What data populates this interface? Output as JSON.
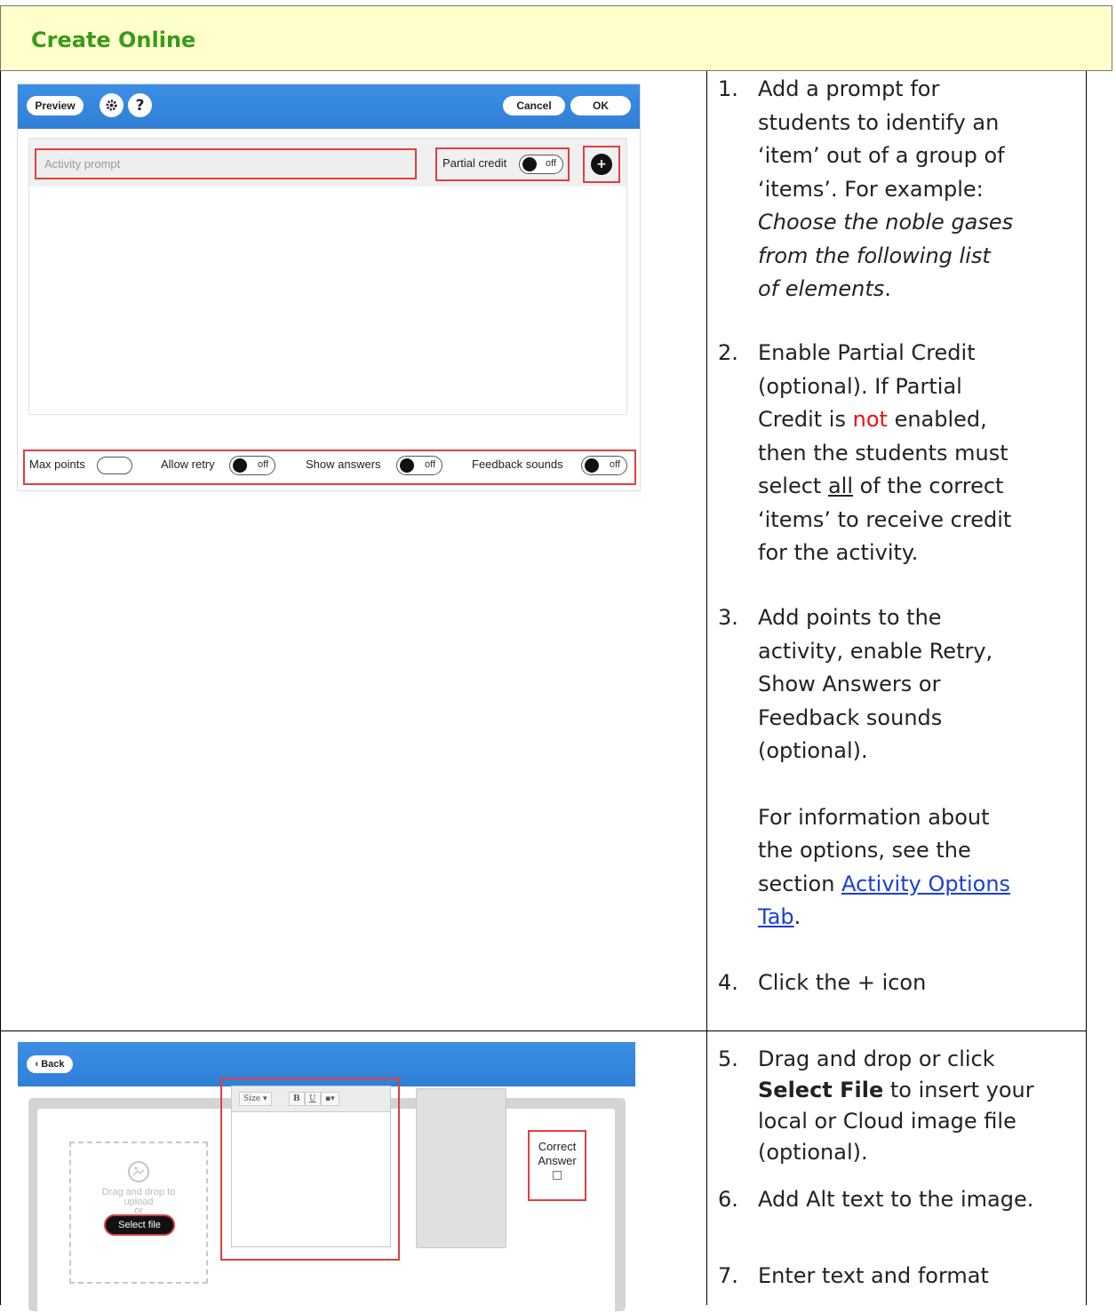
{
  "header": {
    "title": "Create Online"
  },
  "steps": {
    "s1": {
      "num": "1.",
      "l1": "Add a prompt for",
      "l2": "students to identify an",
      "l3": "‘item’ out of a group of",
      "l4": "‘items’. For example:",
      "l5": "Choose the noble gases",
      "l6": "from the following list",
      "l7a": "of elements",
      "l7b": "."
    },
    "s2": {
      "num": "2.",
      "l1": "Enable Partial Credit",
      "l2": "(optional). If Partial",
      "l3a": "Credit is",
      "l3red": "not",
      "l3b": "enabled,",
      "l4": "then the students must",
      "l5a": "select",
      "l5u": "all",
      "l5b": "of the correct",
      "l6": "‘items’ to receive credit",
      "l7": "for the activity."
    },
    "s3": {
      "num": "3.",
      "l1": "Add points to the",
      "l2": "activity, enable Retry,",
      "l3": "Show Answers or",
      "l4": "Feedback sounds",
      "l5": "(optional).",
      "p1": "For information about",
      "p2": "the options, see the",
      "p3a": "section",
      "p3link": "Activity Options",
      "p4link": "Tab",
      "p4b": "."
    },
    "s4": {
      "num": "4.",
      "text": "Click the + icon"
    },
    "s5": {
      "num": "5.",
      "l1": "Drag and drop or click",
      "l2bold": "Select File",
      "l2b": "to insert your",
      "l3": "local or Cloud image file",
      "l4": "(optional)."
    },
    "s6": {
      "num": "6.",
      "text": "Add Alt text to the image."
    },
    "s7": {
      "num": "7.",
      "text": "Enter text and format"
    }
  },
  "screen1": {
    "preview": "Preview",
    "gear_icon": "gear-icon",
    "help": "?",
    "cancel": "Cancel",
    "ok": "OK",
    "prompt_placeholder": "Activity prompt",
    "partial_credit": "Partial credit",
    "toggle_off": "off",
    "plus": "+",
    "max_points": "Max points",
    "allow_retry": "Allow retry",
    "show_answers": "Show answers",
    "feedback_sounds": "Feedback sounds"
  },
  "screen2": {
    "back": "‹ Back",
    "drag_drop_1": "Drag and drop to",
    "drag_drop_2": "upload",
    "or": "or",
    "select_file": "Select file",
    "size": "Size",
    "bold": "B",
    "underline": "U",
    "correct_1": "Correct",
    "correct_2": "Answer"
  },
  "colors": {
    "accent_green": "#3a9a1a",
    "highlight_red": "#e04040",
    "link_blue": "#1a3fd8",
    "toolbar_blue": "#2f7fd6",
    "header_bg": "#ffffcc"
  }
}
